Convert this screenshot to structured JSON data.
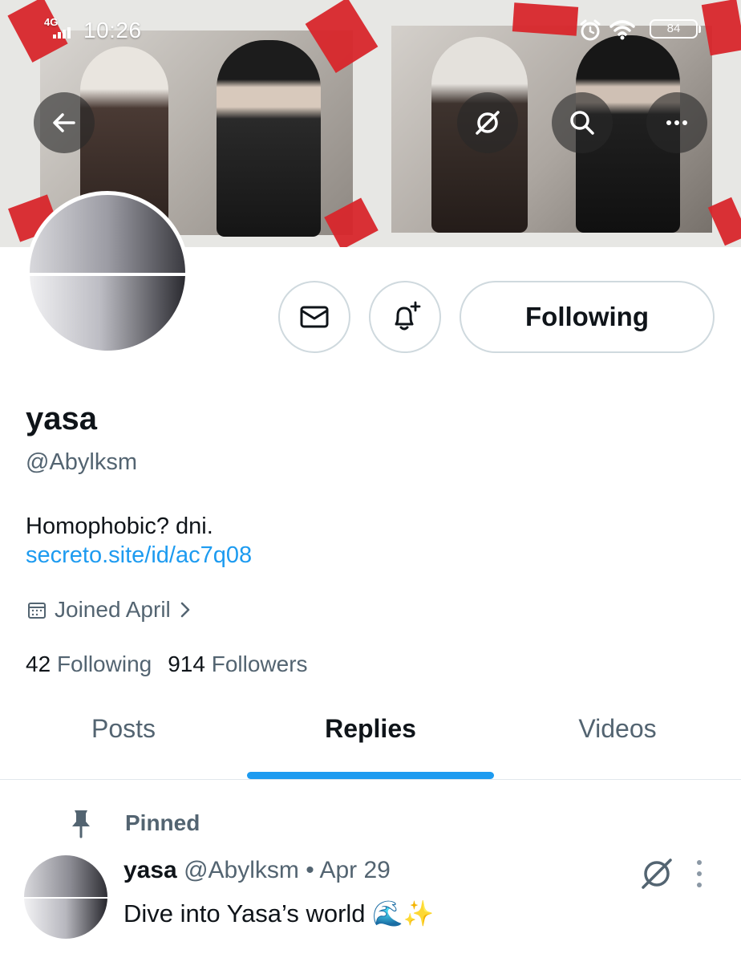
{
  "status_bar": {
    "network": "4G",
    "time": "10:26",
    "battery": "84"
  },
  "header": {
    "back_icon": "arrow-left-icon",
    "grok_icon": "grok-icon",
    "search_icon": "search-icon",
    "more_icon": "more-horizontal-icon"
  },
  "actions": {
    "message_icon": "mail-icon",
    "notify_icon": "bell-plus-icon",
    "following_label": "Following"
  },
  "profile": {
    "display_name": "yasa",
    "handle": "@Abylksm",
    "bio": "Homophobic? dni.",
    "link": "secreto.site/id/ac7q08",
    "joined": "Joined April",
    "following_count": "42",
    "following_label": "Following",
    "followers_count": "914",
    "followers_label": "Followers"
  },
  "tabs": [
    {
      "label": "Posts",
      "active": false
    },
    {
      "label": "Replies",
      "active": true
    },
    {
      "label": "Videos",
      "active": false
    }
  ],
  "pinned_post": {
    "pinned_label": "Pinned",
    "name": "yasa",
    "handle": "@Abylksm",
    "separator": "•",
    "date": "Apr 29",
    "text": "Dive into Yasa’s world 🌊✨"
  },
  "colors": {
    "accent": "#1d9bf0",
    "secondary_text": "#536471",
    "border": "#cfd9de"
  }
}
